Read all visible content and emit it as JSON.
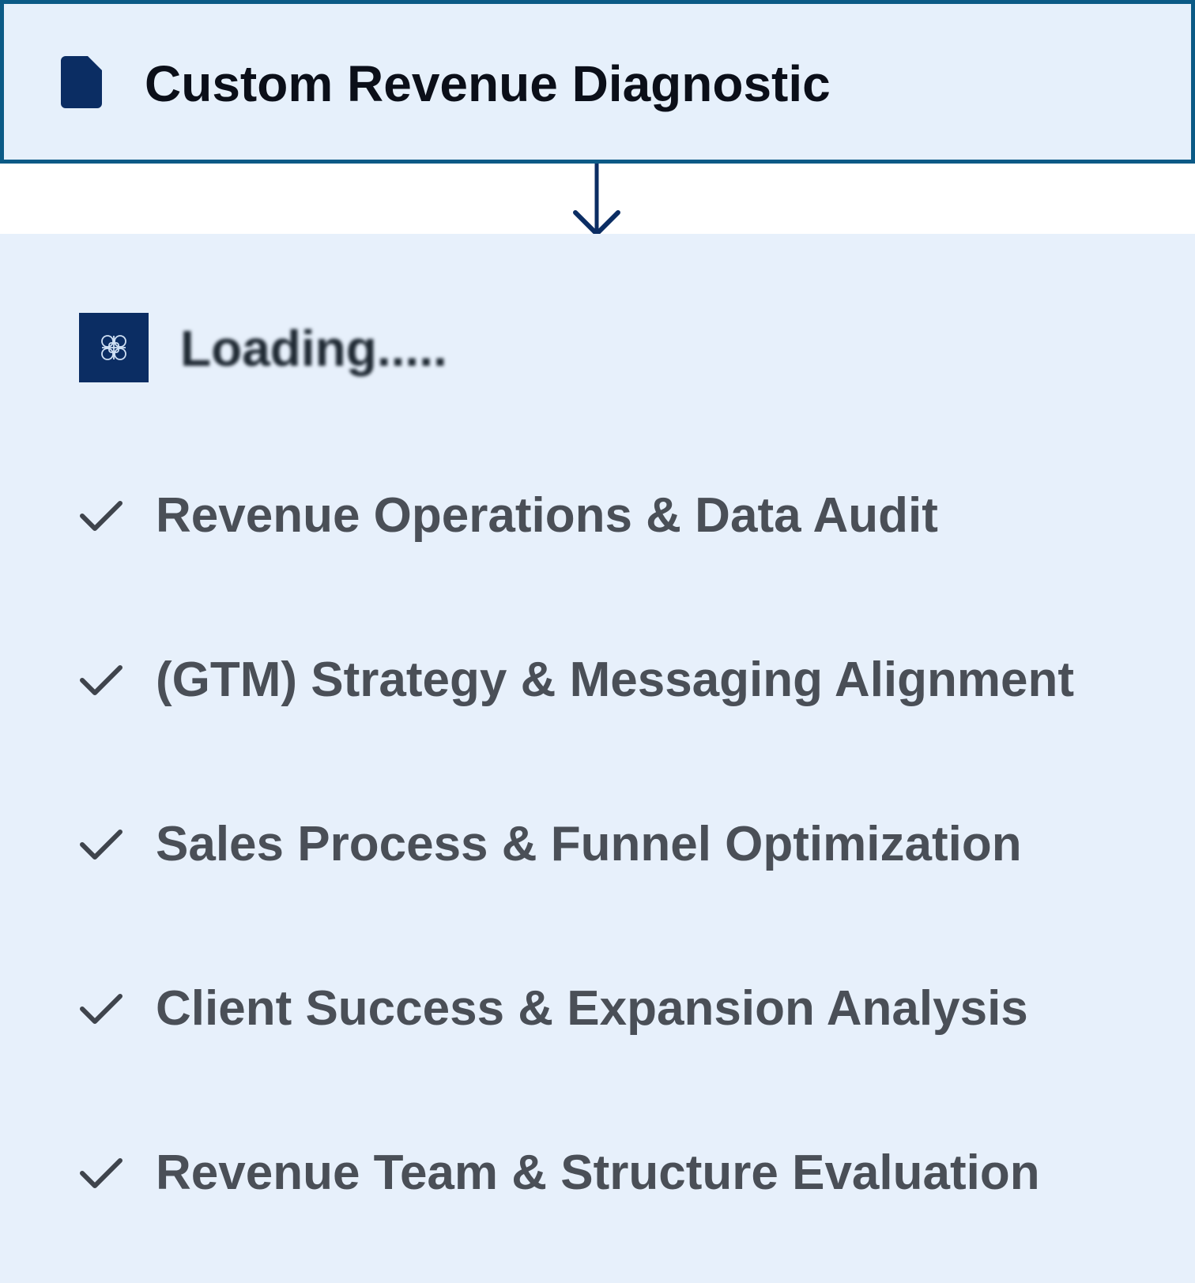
{
  "header": {
    "title": "Custom Revenue Diagnostic",
    "icon": "document-icon"
  },
  "connector": {
    "icon": "arrow-down-icon"
  },
  "loading": {
    "logo_icon": "brand-logo-icon",
    "text": "Loading....."
  },
  "checklist": {
    "items": [
      {
        "label": "Revenue Operations & Data Audit"
      },
      {
        "label": "(GTM) Strategy & Messaging Alignment"
      },
      {
        "label": "Sales Process & Funnel Optimization"
      },
      {
        "label": "Client Success & Expansion Analysis"
      },
      {
        "label": "Revenue Team & Structure Evaluation"
      }
    ],
    "icon": "checkmark-icon"
  },
  "colors": {
    "header_border": "#0b5a86",
    "header_bg": "#e6f0fb",
    "panel_bg": "#e7f0fb",
    "brand_navy": "#0b2d63",
    "check_text": "#4a4f57"
  }
}
